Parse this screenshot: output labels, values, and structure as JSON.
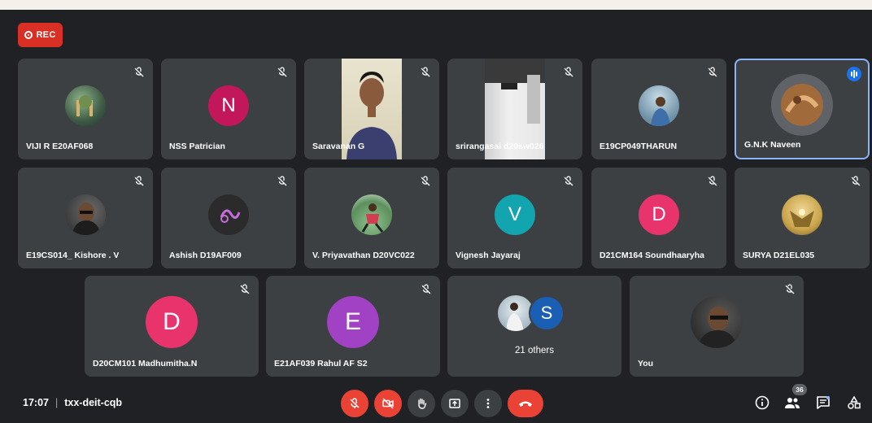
{
  "recording": {
    "label": "REC"
  },
  "participants": [
    {
      "name": "VIJI R E20AF068",
      "type": "photo",
      "photo_color": "#4d6b57"
    },
    {
      "name": "NSS Patrician",
      "type": "letter",
      "letter": "N",
      "color": "#c2185b"
    },
    {
      "name": "Saravanan G",
      "type": "video"
    },
    {
      "name": "srirangasai d20sw026",
      "type": "video"
    },
    {
      "name": "E19CP049THARUN",
      "type": "photo",
      "photo_color": "#6d8fa3"
    },
    {
      "name": "G.N.K Naveen",
      "type": "photo",
      "photo_color": "#a06a3a"
    },
    {
      "name": "E19CS014_ Kishore . V",
      "type": "photo",
      "photo_color": "#3b3b3b"
    },
    {
      "name": "Ashish D19AF009",
      "type": "photo",
      "photo_color": "#2b2b2b"
    },
    {
      "name": "V. Priyavathan D20VC022",
      "type": "photo",
      "photo_color": "#6aa86a"
    },
    {
      "name": "Vignesh Jayaraj",
      "type": "letter",
      "letter": "V",
      "color": "#12a4af"
    },
    {
      "name": "D21CM164 Soundhaaryha",
      "type": "letter",
      "letter": "D",
      "color": "#e8336d"
    },
    {
      "name": "SURYA D21EL035",
      "type": "photo",
      "photo_color": "#c9a44b"
    },
    {
      "name": "D20CM101 Madhumitha.N",
      "type": "letter",
      "letter": "D",
      "color": "#e8336d"
    },
    {
      "name": "E21AF039 Rahul AF S2",
      "type": "letter",
      "letter": "E",
      "color": "#a142c4"
    },
    {
      "name": "",
      "type": "others",
      "label": "21 others",
      "letter": "S",
      "color": "#1a5fb4"
    },
    {
      "name": "You",
      "type": "photo",
      "photo_color": "#2f2f2f"
    }
  ],
  "meeting": {
    "time": "17:07",
    "separator": "|",
    "code": "txx-deit-cqb"
  },
  "people_count": "36",
  "colors": {
    "background": "#202124",
    "tile": "#3c4043",
    "danger": "#ea4335",
    "speaking": "#8ab4f8",
    "accent": "#1a73e8"
  },
  "icons": [
    "mic-off-icon",
    "camera-off-icon",
    "raise-hand-icon",
    "present-icon",
    "more-options-icon",
    "leave-call-icon",
    "info-icon",
    "people-icon",
    "chat-icon",
    "activities-icon"
  ]
}
